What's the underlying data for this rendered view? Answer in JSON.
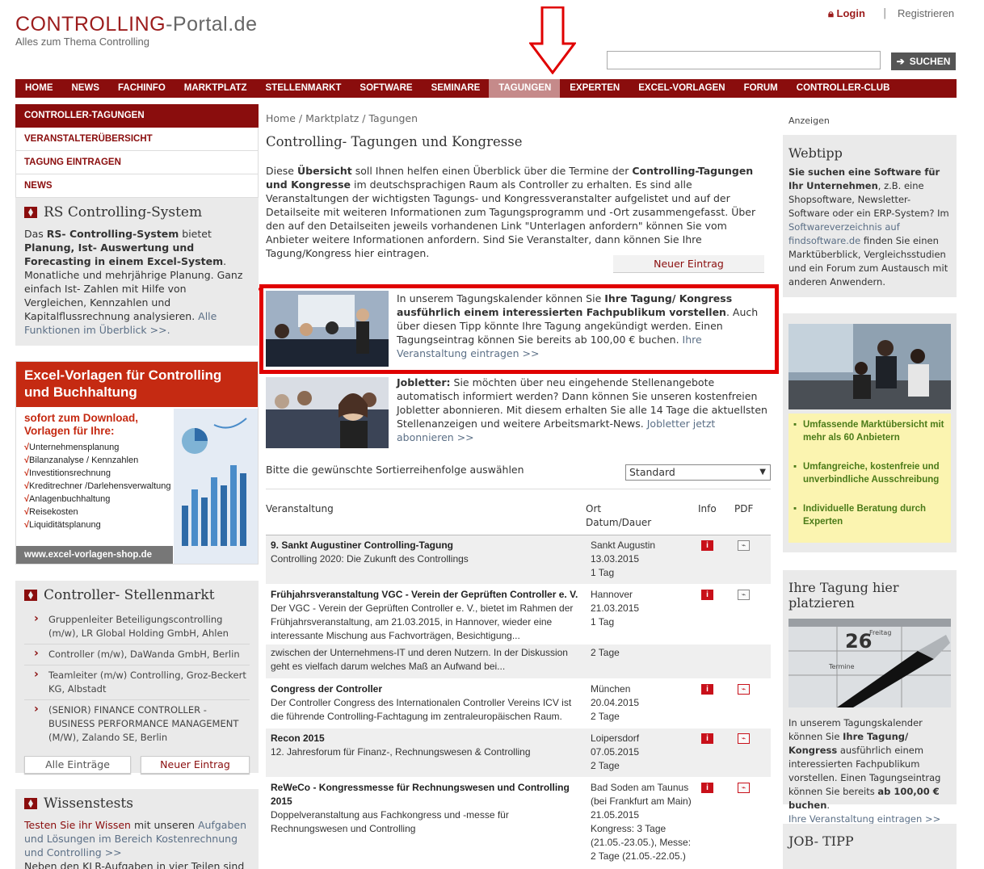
{
  "header": {
    "logo_main": "CONTROLLING",
    "logo_suffix": "-Portal.de",
    "logo_sub": "Alles zum Thema Controlling",
    "login": "Login",
    "separator": "|",
    "register": "Registrieren",
    "search_value": "",
    "search_button": "SUCHEN"
  },
  "nav": [
    "HOME",
    "NEWS",
    "FACHINFO",
    "MARKTPLATZ",
    "STELLENMARKT",
    "SOFTWARE",
    "SEMINARE",
    "TAGUNGEN",
    "EXPERTEN",
    "EXCEL-VORLAGEN",
    "FORUM",
    "CONTROLLER-CLUB"
  ],
  "nav_active": "TAGUNGEN",
  "left": {
    "menu": [
      "CONTROLLER-TAGUNGEN",
      "VERANSTALTERÜBERSICHT",
      "TAGUNG EINTRAGEN",
      "NEWS"
    ],
    "rs": {
      "title": "RS Controlling-System",
      "t1": "Das ",
      "t2": "RS- Controlling-System",
      "t3": " bietet ",
      "t4": "Planung, Ist- Auswertung und Forecasting in einem Excel-System",
      "t5": ". Monatliche und mehrjährige Planung. Ganz einfach Ist- Zahlen mit Hilfe von Vergleichen, Kennzahlen und Kapitalflussrechnung analysieren.",
      "link": "Alle Funktionen im Überblick >>."
    },
    "excel": {
      "head": "Excel-Vorlagen für Controlling und Buchhaltung",
      "sub": "sofort zum Download, Vorlagen für Ihre:",
      "items": [
        "Unternehmensplanung",
        "Bilanzanalyse / Kennzahlen",
        "Investitionsrechnung",
        "Kreditrechner /Darlehensverwaltung",
        "Anlagenbuchhaltung",
        "Reisekosten",
        "Liquiditätsplanung"
      ],
      "check": "√",
      "url": "www.excel-vorlagen-shop.de"
    },
    "jobs": {
      "title": "Controller- Stellenmarkt",
      "items": [
        "Gruppenleiter Beteiligungscontrolling (m/w), LR Global Holding GmbH, Ahlen",
        "Controller (m/w), DaWanda GmbH, Berlin",
        "Teamleiter (m/w) Controlling, Groz-Beckert KG, Albstadt",
        "(SENIOR) FINANCE CONTROLLER - BUSINESS PERFORMANCE MANAGEMENT (M/W), Zalando SE, Berlin"
      ],
      "all_button": "Alle Einträge",
      "new_button": "Neuer Eintrag"
    },
    "wissen": {
      "title": "Wissenstests",
      "link1": "Testen Sie ihr Wissen",
      "t1": " mit unseren ",
      "link2": "Aufgaben und Lösungen im Bereich Kostenrechnung und Controlling >>",
      "t2": "Neben den KLR-Aufgaben in vier Teilen sind"
    }
  },
  "main": {
    "breadcrumb": "Home / Marktplatz / Tagungen",
    "title": "Controlling- Tagungen und Kongresse",
    "intro_1": "Diese ",
    "intro_2": "Übersicht",
    "intro_3": " soll Ihnen helfen einen Überblick über die Termine der ",
    "intro_4": "Controlling-Tagungen und Kongresse",
    "intro_5": " im deutschsprachigen Raum als Controller zu erhalten. Es sind alle Veranstaltungen der wichtigsten Tagungs- und Kongressveranstalter aufgelistet und auf der Detailseite mit weiteren Informationen zum Tagungsprogramm und -Ort zusammengefasst. Über den auf den Detailseiten jeweils vorhandenen Link \"Unterlagen anfordern\" können Sie vom Anbieter weitere Informationen anfordern. Sind Sie Veranstalter, dann können Sie Ihre Tagung/Kongress hier eintragen.",
    "new_entry": "Neuer Eintrag",
    "tip1_1": "In unserem Tagungskalender können Sie ",
    "tip1_2": "Ihre Tagung/ Kongress ausführlich einem interessierten Fachpublikum vorstellen",
    "tip1_3": ". Auch über diesen Tipp könnte Ihre Tagung angekündigt werden. Einen Tagungseintrag können Sie bereits ab 100,00 € buchen. ",
    "tip1_link": "Ihre Veranstaltung eintragen >>",
    "tip2_1": "Jobletter:",
    "tip2_2": " Sie möchten über neu eingehende Stellenangebote automatisch informiert werden? Dann können Sie unseren kostenfreien Jobletter abonnieren. Mit diesem erhalten Sie alle 14 Tage die aktuellsten Stellenanzeigen und weitere Arbeitsmarkt-News. ",
    "tip2_link": "Jobletter jetzt abonnieren >>",
    "sort_label": "Bitte die gewünschte Sortierreihenfolge auswählen",
    "sort_value": "Standard",
    "th_event": "Veranstaltung",
    "th_place": "Ort",
    "th_date": "Datum/Dauer",
    "th_info": "Info",
    "th_pdf": "PDF",
    "rows": [
      {
        "title": "9. Sankt Augustiner Controlling-Tagung",
        "desc": "Controlling 2020: Die Zukunft des Controllings",
        "place": "Sankt Augustin",
        "date": "13.03.2015",
        "dur": "1 Tag"
      },
      {
        "title": "Frühjahrsveranstaltung VGC - Verein der Geprüften Controller e. V.",
        "desc": "Der VGC - Verein der Geprüften Controller e. V., bietet im Rahmen der Frühjahrsveranstaltung, am 21.03.2015, in Hannover, wieder eine interessante Mischung aus Fachvorträgen, Besichtigung...",
        "place": "Hannover",
        "date": "21.03.2015",
        "dur": "1 Tag"
      },
      {
        "title": "",
        "desc": "zwischen der Unternehmens-IT und deren Nutzern. In der Diskussion geht es vielfach darum welches Maß an Aufwand bei...",
        "place": "2 Tage",
        "date": "",
        "dur": ""
      },
      {
        "title": "Congress der Controller",
        "desc": "Der Controller Congress des Internationalen Controller Vereins ICV ist die führende Controlling-Fachtagung im zentraleuropäischen Raum.",
        "place": "München",
        "date": "20.04.2015",
        "dur": "2 Tage"
      },
      {
        "title": "Recon 2015",
        "desc": "12. Jahresforum für Finanz-, Rechnungswesen & Controlling",
        "place": "Loipersdorf",
        "date": "07.05.2015",
        "dur": "2 Tage"
      },
      {
        "title": "ReWeCo - Kongressmesse für Rechnungswesen und Controlling 2015",
        "desc": "Doppelveranstaltung aus Fachkongress und -messe für Rechnungswesen und Controlling",
        "place": "Bad Soden am Taunus (bei Frankfurt am Main)",
        "date": "21.05.2015",
        "dur": "Kongress: 3 Tage (21.05.-23.05.), Messe: 2 Tage (21.05.-22.05.)"
      }
    ],
    "info_icon": "i",
    "pdf_icon": "⌁"
  },
  "right": {
    "ads": "Anzeigen",
    "webtipp_title": "Webtipp",
    "webtipp_1": "Sie suchen eine Software für Ihr Unternehmen",
    "webtipp_2": ", z.B. eine Shopsoftware, Newsletter-Software oder ein ERP-System? Im ",
    "webtipp_link": "Softwareverzeichnis auf findsoftware.de",
    "webtipp_3": " finden Sie einen Marktüberblick, Vergleichsstudien und ein Forum zum Austausch mit anderen Anwendern.",
    "fs_items": [
      "Umfassende Marktübersicht mit mehr als 60 Anbietern",
      "Umfangreiche, kostenfreie und unverbindliche Ausschreibung",
      "Individuelle Beratung durch Experten"
    ],
    "own_title": "Ihre Tagung hier platzieren",
    "own_1": "In unserem Tagungskalender können Sie ",
    "own_2": "Ihre Tagung/ Kongress",
    "own_3": " ausführlich einem interessierten Fachpublikum vorstellen. Einen Tagungseintrag können Sie bereits ",
    "own_4": "ab 100,00 € buchen",
    "own_5": ".",
    "own_link": "Ihre Veranstaltung eintragen >>",
    "calendar_day": "26",
    "calendar_weekday": "Freitag",
    "calendar_term": "Termine",
    "jobtipp_title": "JOB- TIPP"
  },
  "colors": {
    "brand": "#8a0d0d",
    "nav_active": "#c58a8a",
    "highlight_box": "#e00000",
    "excel_red": "#c52a12"
  }
}
